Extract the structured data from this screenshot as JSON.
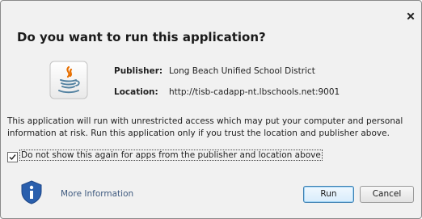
{
  "dialog": {
    "title": "Do you want to run this application?",
    "close_icon": "close-icon"
  },
  "app_info": {
    "icon": "java-logo-icon",
    "publisher_label": "Publisher:",
    "publisher_value": "Long Beach Unified School District",
    "location_label": "Location:",
    "location_value": "http://tisb-cadapp-nt.lbschools.net:9001"
  },
  "warning_text": "This application will run with unrestricted access which may put your computer and personal information at risk. Run this application only if you trust the location and publisher above.",
  "do_not_show": {
    "checked": true,
    "label": "Do not show this again for apps from the publisher and location above"
  },
  "footer": {
    "info_icon": "shield-info-icon",
    "more_info_label": "More Information",
    "run_label": "Run",
    "cancel_label": "Cancel"
  },
  "colors": {
    "background": "#f1f1f1",
    "link": "#3f5a7f",
    "shield": "#2a5fad",
    "java_orange": "#e76f00",
    "java_blue": "#5382a1"
  }
}
